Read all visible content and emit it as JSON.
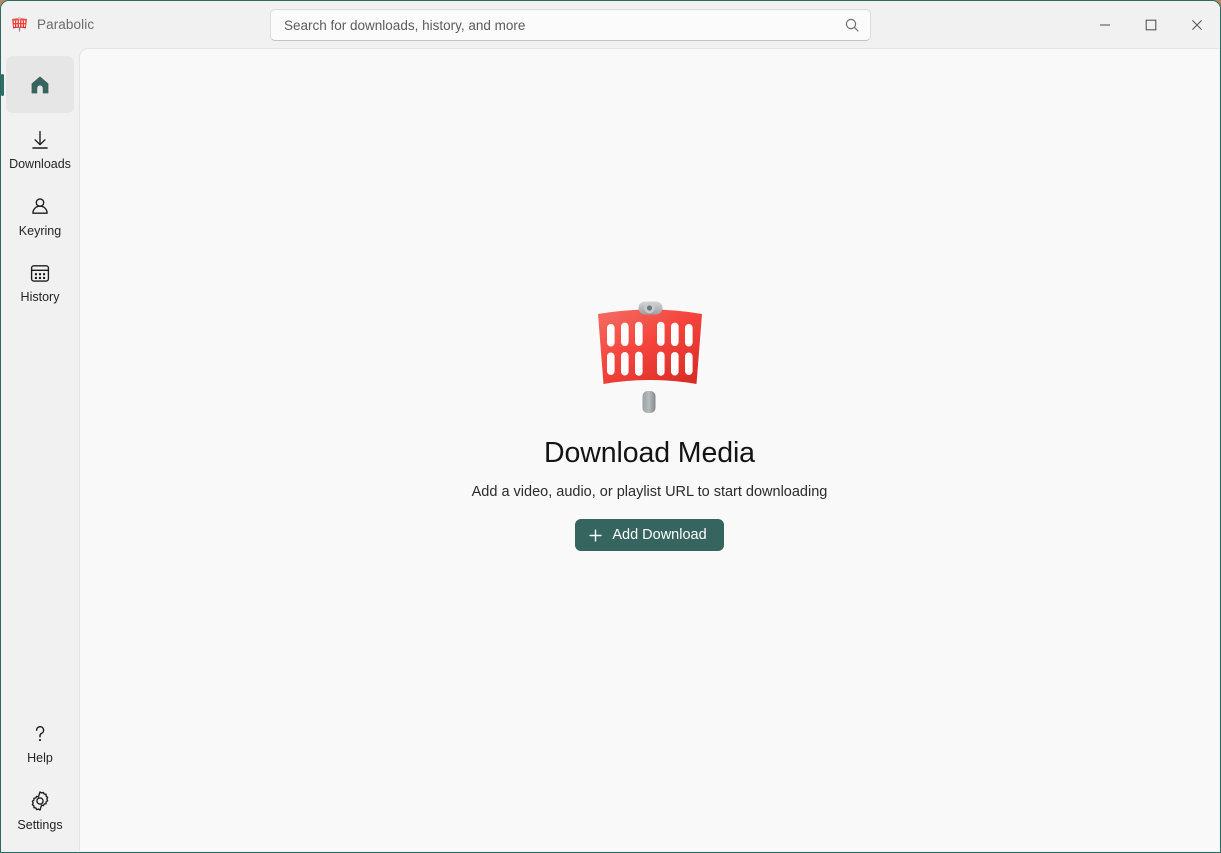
{
  "window": {
    "title": "Parabolic",
    "app_icon": "parabolic-logo-icon",
    "border_color": "#2a6a63",
    "titlebar_bg": "#f1f1f1"
  },
  "search": {
    "placeholder": "Search for downloads, history, and more",
    "value": "",
    "icon": "search-icon"
  },
  "window_controls": [
    {
      "name": "minimize",
      "icon": "minimize-icon",
      "label": "Minimize"
    },
    {
      "name": "maximize",
      "icon": "maximize-icon",
      "label": "Maximize"
    },
    {
      "name": "close",
      "icon": "close-icon",
      "label": "Close"
    }
  ],
  "sidebar": {
    "accent_color": "#2e6e67",
    "selected_bg": "#e6e6e6",
    "top_items": [
      {
        "id": "home",
        "label": "",
        "icon": "home-icon",
        "selected": true
      },
      {
        "id": "downloads",
        "label": "Downloads",
        "icon": "download-icon",
        "selected": false
      },
      {
        "id": "keyring",
        "label": "Keyring",
        "icon": "person-icon",
        "selected": false
      },
      {
        "id": "history",
        "label": "History",
        "icon": "calendar-icon",
        "selected": false
      }
    ],
    "bottom_items": [
      {
        "id": "help",
        "label": "Help",
        "icon": "question-mark-icon",
        "selected": false
      },
      {
        "id": "settings",
        "label": "Settings",
        "icon": "gear-icon",
        "selected": false
      }
    ]
  },
  "main": {
    "logo_icon": "parabolic-logo-icon",
    "logo_colors": {
      "dish": "#f4443c",
      "dish_dark": "#d62b2b",
      "pole": "#8e9396"
    },
    "title": "Download Media",
    "subtitle": "Add a video, audio, or playlist URL to start downloading",
    "add_button": {
      "label": "Add Download",
      "icon": "plus-icon",
      "color": "#35655e"
    }
  }
}
